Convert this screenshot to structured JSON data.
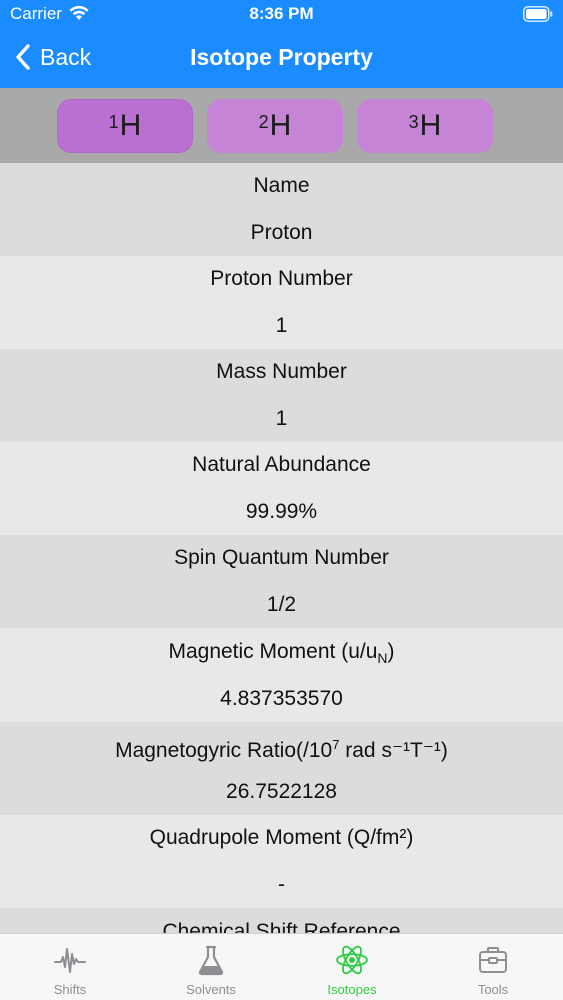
{
  "status_bar": {
    "carrier": "Carrier",
    "time": "8:36 PM"
  },
  "nav": {
    "back_label": "Back",
    "title": "Isotope Property"
  },
  "isotopes": [
    {
      "mass": "1",
      "symbol": "H",
      "selected": true
    },
    {
      "mass": "2",
      "symbol": "H",
      "selected": false
    },
    {
      "mass": "3",
      "symbol": "H",
      "selected": false
    }
  ],
  "properties": [
    {
      "label": "Name",
      "value": "Proton"
    },
    {
      "label": "Proton Number",
      "value": "1"
    },
    {
      "label": "Mass Number",
      "value": "1"
    },
    {
      "label": "Natural Abundance",
      "value": "99.99%"
    },
    {
      "label": "Spin Quantum Number",
      "value": "1/2"
    },
    {
      "label_main": "Magnetic Moment (u/u",
      "label_sub": "N",
      "label_end": ")",
      "value": "4.837353570"
    },
    {
      "label_main": "Magnetogyric Ratio(/10",
      "label_sup": "7",
      "label_end": " rad s⁻¹T⁻¹)",
      "value": "26.7522128"
    },
    {
      "label": "Quadrupole Moment (Q/fm²)",
      "value": "-"
    },
    {
      "label": "Chemical Shift Reference",
      "value": ""
    }
  ],
  "tabs": [
    {
      "label": "Shifts",
      "icon": "waveform-icon",
      "active": false
    },
    {
      "label": "Solvents",
      "icon": "flask-icon",
      "active": false
    },
    {
      "label": "Isotopes",
      "icon": "atom-icon",
      "active": true
    },
    {
      "label": "Tools",
      "icon": "toolbox-icon",
      "active": false
    }
  ],
  "colors": {
    "nav_blue": "#1a8cff",
    "isotope_button": "#c584d6",
    "active_tab": "#2ecc40",
    "inactive_tab": "#8e8e93"
  }
}
